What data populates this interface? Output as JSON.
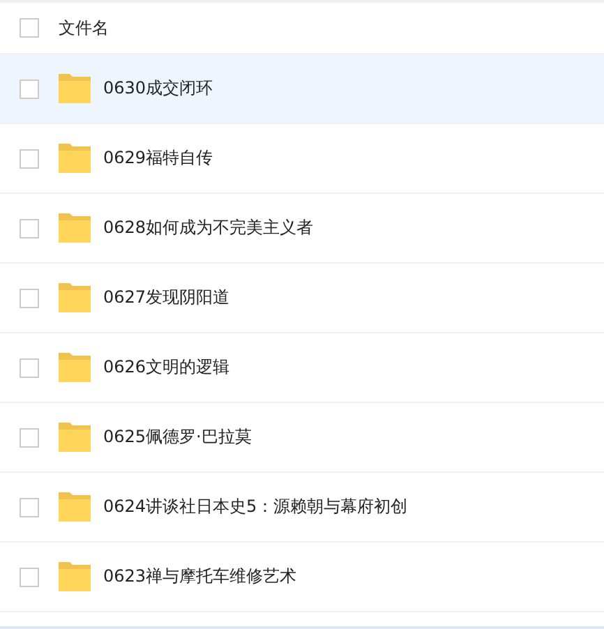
{
  "header": {
    "checked": false,
    "label": "文件名"
  },
  "rows": [
    {
      "name": "0630成交闭环",
      "checked": false,
      "hovered": true
    },
    {
      "name": "0629福特自传",
      "checked": false,
      "hovered": false
    },
    {
      "name": "0628如何成为不完美主义者",
      "checked": false,
      "hovered": false
    },
    {
      "name": "0627发现阴阳道",
      "checked": false,
      "hovered": false
    },
    {
      "name": "0626文明的逻辑",
      "checked": false,
      "hovered": false
    },
    {
      "name": "0625佩德罗·巴拉莫",
      "checked": false,
      "hovered": false
    },
    {
      "name": "0624讲谈社日本史5：源赖朝与幕府初创",
      "checked": false,
      "hovered": false
    },
    {
      "name": "0623禅与摩托车维修艺术",
      "checked": false,
      "hovered": false
    }
  ]
}
